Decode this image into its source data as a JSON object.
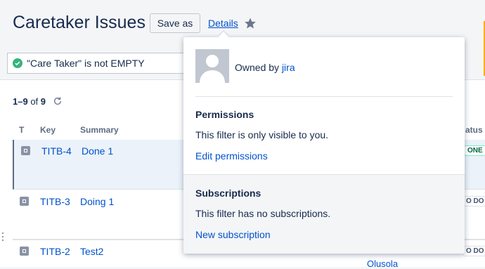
{
  "header": {
    "title": "Caretaker Issues",
    "save_as_label": "Save as",
    "details_label": "Details",
    "star_icon": "star-icon",
    "filter_text": "\"Care Taker\" is not EMPTY"
  },
  "results": {
    "range": "1–9",
    "of_label": "of",
    "total": "9"
  },
  "columns": {
    "type": "T",
    "key": "Key",
    "summary": "Summary",
    "status": "atus"
  },
  "rows": [
    {
      "key": "TITB-4",
      "summary": "Done 1",
      "status": "ONE"
    },
    {
      "key": "TITB-3",
      "summary": "Doing 1",
      "status": "O DO"
    },
    {
      "key": "TITB-2",
      "summary": "Test2",
      "status": "O DO"
    }
  ],
  "assignee_partial": "Olusola",
  "popup": {
    "owned_by_label": "Owned by",
    "owner": "jira",
    "permissions_heading": "Permissions",
    "permissions_text": "This filter is only visible to you.",
    "edit_permissions_label": "Edit permissions",
    "subscriptions_heading": "Subscriptions",
    "subscriptions_text": "This filter has no subscriptions.",
    "new_subscription_label": "New subscription"
  },
  "colors": {
    "link": "#0052cc",
    "text": "#172b4d",
    "done_green": "#006644",
    "check_green": "#36b37e"
  }
}
